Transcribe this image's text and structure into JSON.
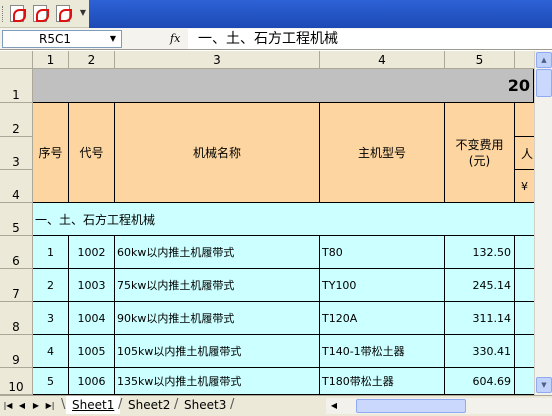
{
  "formula_bar": {
    "name_box": "R5C1",
    "fx_label": "fx",
    "formula": "一、土、石方工程机械"
  },
  "columns": [
    "1",
    "2",
    "3",
    "4",
    "5"
  ],
  "rows": [
    "1",
    "2",
    "3",
    "4",
    "5",
    "6",
    "7",
    "8",
    "9",
    "10"
  ],
  "header": {
    "title_partial": "20",
    "seq": "序号",
    "code": "代号",
    "name": "机械名称",
    "model": "主机型号",
    "fixed_cost": "不变费用\n(元)",
    "partial_col6_row3": "人",
    "partial_col6_row4": "¥"
  },
  "section": "一、土、石方工程机械",
  "data_rows": [
    {
      "seq": "1",
      "code": "1002",
      "name": "60kw以内推土机履带式",
      "model": "T80",
      "cost": "132.50"
    },
    {
      "seq": "2",
      "code": "1003",
      "name": "75kw以内推土机履带式",
      "model": "TY100",
      "cost": "245.14"
    },
    {
      "seq": "3",
      "code": "1004",
      "name": "90kw以内推土机履带式",
      "model": "T120A",
      "cost": "311.14"
    },
    {
      "seq": "4",
      "code": "1005",
      "name": "105kw以内推土机履带式",
      "model": "T140-1带松土器",
      "cost": "330.41"
    },
    {
      "seq": "5",
      "code": "1006",
      "name": "135kw以内推土机履带式",
      "model": "T180带松土器",
      "cost": "604.69"
    }
  ],
  "sheet_tabs": [
    "Sheet1",
    "Sheet2",
    "Sheet3"
  ],
  "colors": {
    "header_fill": "#fcd5a0",
    "section_fill": "#ccffff",
    "title_fill": "#c0c0c0"
  }
}
